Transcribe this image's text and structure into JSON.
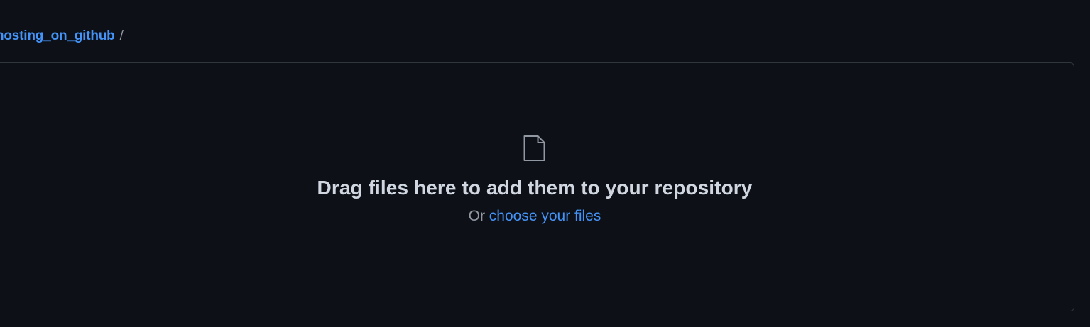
{
  "breadcrumb": {
    "repo_name": "hosting_on_github",
    "separator": "/"
  },
  "dropzone": {
    "icon": "file-icon",
    "title": "Drag files here to add them to your repository",
    "or_text": "Or",
    "choose_link": "choose your files"
  },
  "colors": {
    "background": "#0d1117",
    "border": "#30363d",
    "link": "#4493f8",
    "title_text": "#d1d7e0",
    "muted_text": "#9198a1"
  }
}
